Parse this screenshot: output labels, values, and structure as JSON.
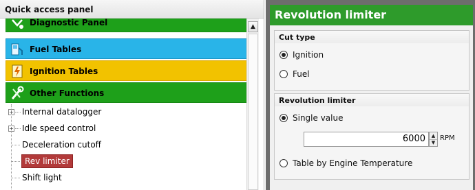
{
  "left_panel": {
    "title": "Quick access panel",
    "categories": [
      {
        "label": "Diagnostic Panel",
        "icon": "stethoscope-icon",
        "color": "#1ea01a"
      },
      {
        "label": "Fuel Tables",
        "icon": "fuel-icon",
        "color": "#29b4e8"
      },
      {
        "label": "Ignition Tables",
        "icon": "ignition-icon",
        "color": "#f2c200"
      },
      {
        "label": "Other Functions",
        "icon": "tools-icon",
        "color": "#1ea01a"
      }
    ],
    "tree": [
      {
        "label": "Internal datalogger",
        "expandable": true,
        "expander": "+"
      },
      {
        "label": "Idle speed control",
        "expandable": true,
        "expander": "+"
      },
      {
        "label": "Deceleration cutoff",
        "expandable": false
      },
      {
        "label": "Rev limiter",
        "expandable": false,
        "selected": true
      },
      {
        "label": "Shift light",
        "expandable": false
      }
    ],
    "scroll_up": "▲"
  },
  "right_panel": {
    "title": "Revolution limiter",
    "title_color": "#2e9b2b",
    "cut_type": {
      "title": "Cut type",
      "options": [
        {
          "label": "Ignition",
          "selected": true
        },
        {
          "label": "Fuel",
          "selected": false
        }
      ]
    },
    "rev_limiter": {
      "title": "Revolution limiter",
      "options": [
        {
          "label": "Single value",
          "selected": true
        },
        {
          "label": "Table by Engine Temperature",
          "selected": false
        }
      ],
      "value": "6000",
      "unit": "RPM",
      "spin_up": "▲",
      "spin_down": "▼"
    }
  }
}
